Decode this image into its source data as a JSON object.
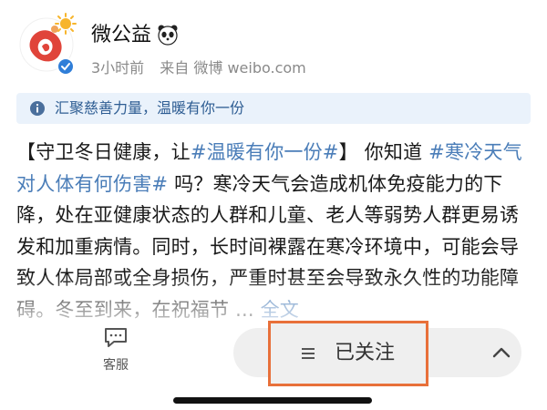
{
  "account": {
    "name": "微公益",
    "time": "3小时前",
    "source": "来自 微博 weibo.com"
  },
  "notice": {
    "text": "汇聚慈善力量，温暖有你一份"
  },
  "post": {
    "seg1": "【守卫冬日健康，让",
    "tag1": "#温暖有你一份#",
    "seg2": "】 你知道 ",
    "tag2": "#寒冷天气对人体有何伤害#",
    "seg3": " 吗？寒冷天气会造成机体免疫能力的下降，处在亚健康状态的人群和儿童、老人等弱势人群更易诱发和加重病情。同时，长时间裸露在寒冷环境中，可能会导致人体局部或全身损伤，严重时甚至会导致永久性的功能障碍。冬至到来，在祝福节 ... ",
    "more": "全文"
  },
  "bottom_bar": {
    "service_label": "客服",
    "follow_label": "已关注"
  },
  "colors": {
    "link": "#4a7db8",
    "highlight_border": "#e8703a",
    "notice_bg": "#eaf2fb",
    "brand_red": "#e0443a"
  }
}
